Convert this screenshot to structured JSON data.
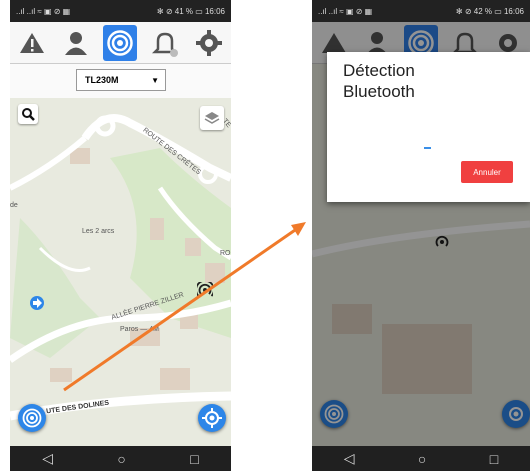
{
  "left_screen": {
    "status_left": "..ıl ..ıl ≈ ▣ ⊘ ▦",
    "status_right": "✻ ⊘ 41 % ▭ 16:06",
    "toolbar_icons": [
      "warning-icon",
      "user-icon",
      "beacon-icon",
      "bell-icon",
      "gear-icon"
    ],
    "device_select": "TL230M",
    "map_labels": {
      "route_des_cretes": "ROUTE DES CRÊTES",
      "les_2_arcs": "Les 2 arcs",
      "allee_pierre_ziller": "ALLÉE PIERRE ZILLER",
      "paros": "Paros — 4M",
      "route_des_dolines": "UTE DES DOLINES",
      "te": "TE",
      "de": "de",
      "ro": "RO"
    }
  },
  "right_screen": {
    "status_left": "..ıl ..ıl ≈ ▣ ⊘ ▦",
    "status_right": "✻ ⊘ 42 % ▭ 16:06",
    "dialog": {
      "title": "Détection Bluetooth",
      "cancel_label": "Annuler"
    }
  },
  "colors": {
    "accent": "#2f80e8",
    "cancel": "#f04040",
    "arrow": "#f07a2a"
  }
}
